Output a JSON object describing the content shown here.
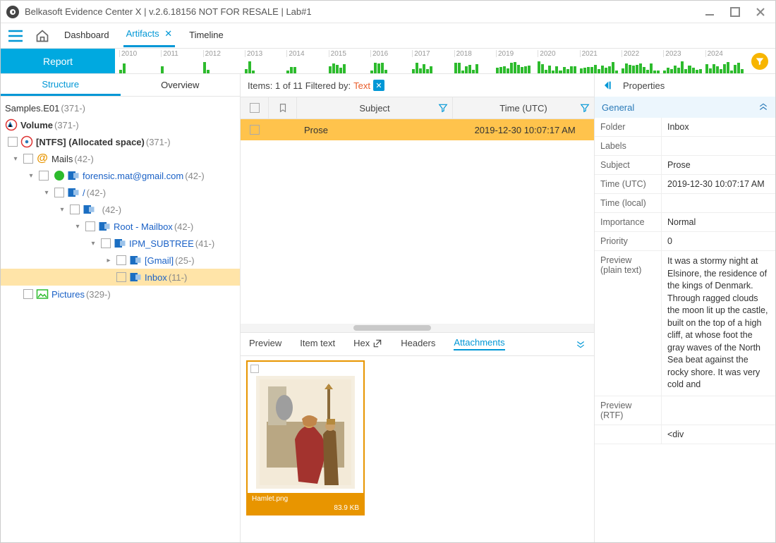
{
  "title": "Belkasoft Evidence Center X | v.2.6.18156 NOT FOR RESALE | Lab#1",
  "nav": {
    "dashboard": "Dashboard",
    "artifacts": "Artifacts",
    "timeline": "Timeline"
  },
  "report_btn": "Report",
  "timeline_years": [
    "2010",
    "2011",
    "2012",
    "2013",
    "2014",
    "2015",
    "2016",
    "2017",
    "2018",
    "2019",
    "2020",
    "2021",
    "2022",
    "2023",
    "2024"
  ],
  "sidebar_tabs": {
    "structure": "Structure",
    "overview": "Overview"
  },
  "tree": {
    "root": "Samples.E01",
    "root_count": "(371-)",
    "volume": "Volume",
    "volume_count": "(371-)",
    "ntfs": "[NTFS] (Allocated space)",
    "ntfs_count": "(371-)",
    "mails": "Mails",
    "mails_count": "(42-)",
    "account": "forensic.mat@gmail.com",
    "account_count": "(42-)",
    "slash": "/",
    "slash_count": "(42-)",
    "blank_count": "(42-)",
    "rootmbx": "Root - Mailbox",
    "rootmbx_count": "(42-)",
    "ipm": "IPM_SUBTREE  ",
    "ipm_count": "(41-)",
    "gmail": "[Gmail]",
    "gmail_count": "(25-)",
    "inbox": "Inbox",
    "inbox_count": "(11-)",
    "pictures": "Pictures",
    "pictures_count": "(329-)"
  },
  "center": {
    "items_label": "Items: 1 of 11",
    "filtered_label": "Filtered by:",
    "filter_value": "Text",
    "col_subject": "Subject",
    "col_time": "Time (UTC)",
    "row_subject": "Prose",
    "row_time": "2019-12-30 10:07:17 AM"
  },
  "detail_tabs": {
    "preview": "Preview",
    "itemtext": "Item text",
    "hex": "Hex",
    "headers": "Headers",
    "attachments": "Attachments"
  },
  "attachment": {
    "name": "Hamlet.png",
    "size": "83.9 KB"
  },
  "props": {
    "title": "Properties",
    "section": "General",
    "rows": {
      "folder_l": "Folder",
      "folder_v": "Inbox",
      "labels_l": "Labels",
      "labels_v": "",
      "subject_l": "Subject",
      "subject_v": "Prose",
      "time_l": "Time (UTC)",
      "time_v": "2019-12-30 10:07:17 AM",
      "tlocal_l": "Time (local)",
      "tlocal_v": "",
      "imp_l": "Importance",
      "imp_v": "Normal",
      "pri_l": "Priority",
      "pri_v": "0",
      "prevpt_l": "Preview (plain text)",
      "prevpt_v": "It was a stormy night at Elsinore, the residence of the kings of Denmark. Through ragged clouds the moon lit up the castle, built on the top of a high cliff, at whose foot the gray waves of the North Sea beat against the rocky shore. It was very cold and",
      "prevrtf_l": "Preview (RTF)",
      "prevrtf_v": "",
      "prevhtml_v": "<div"
    }
  }
}
